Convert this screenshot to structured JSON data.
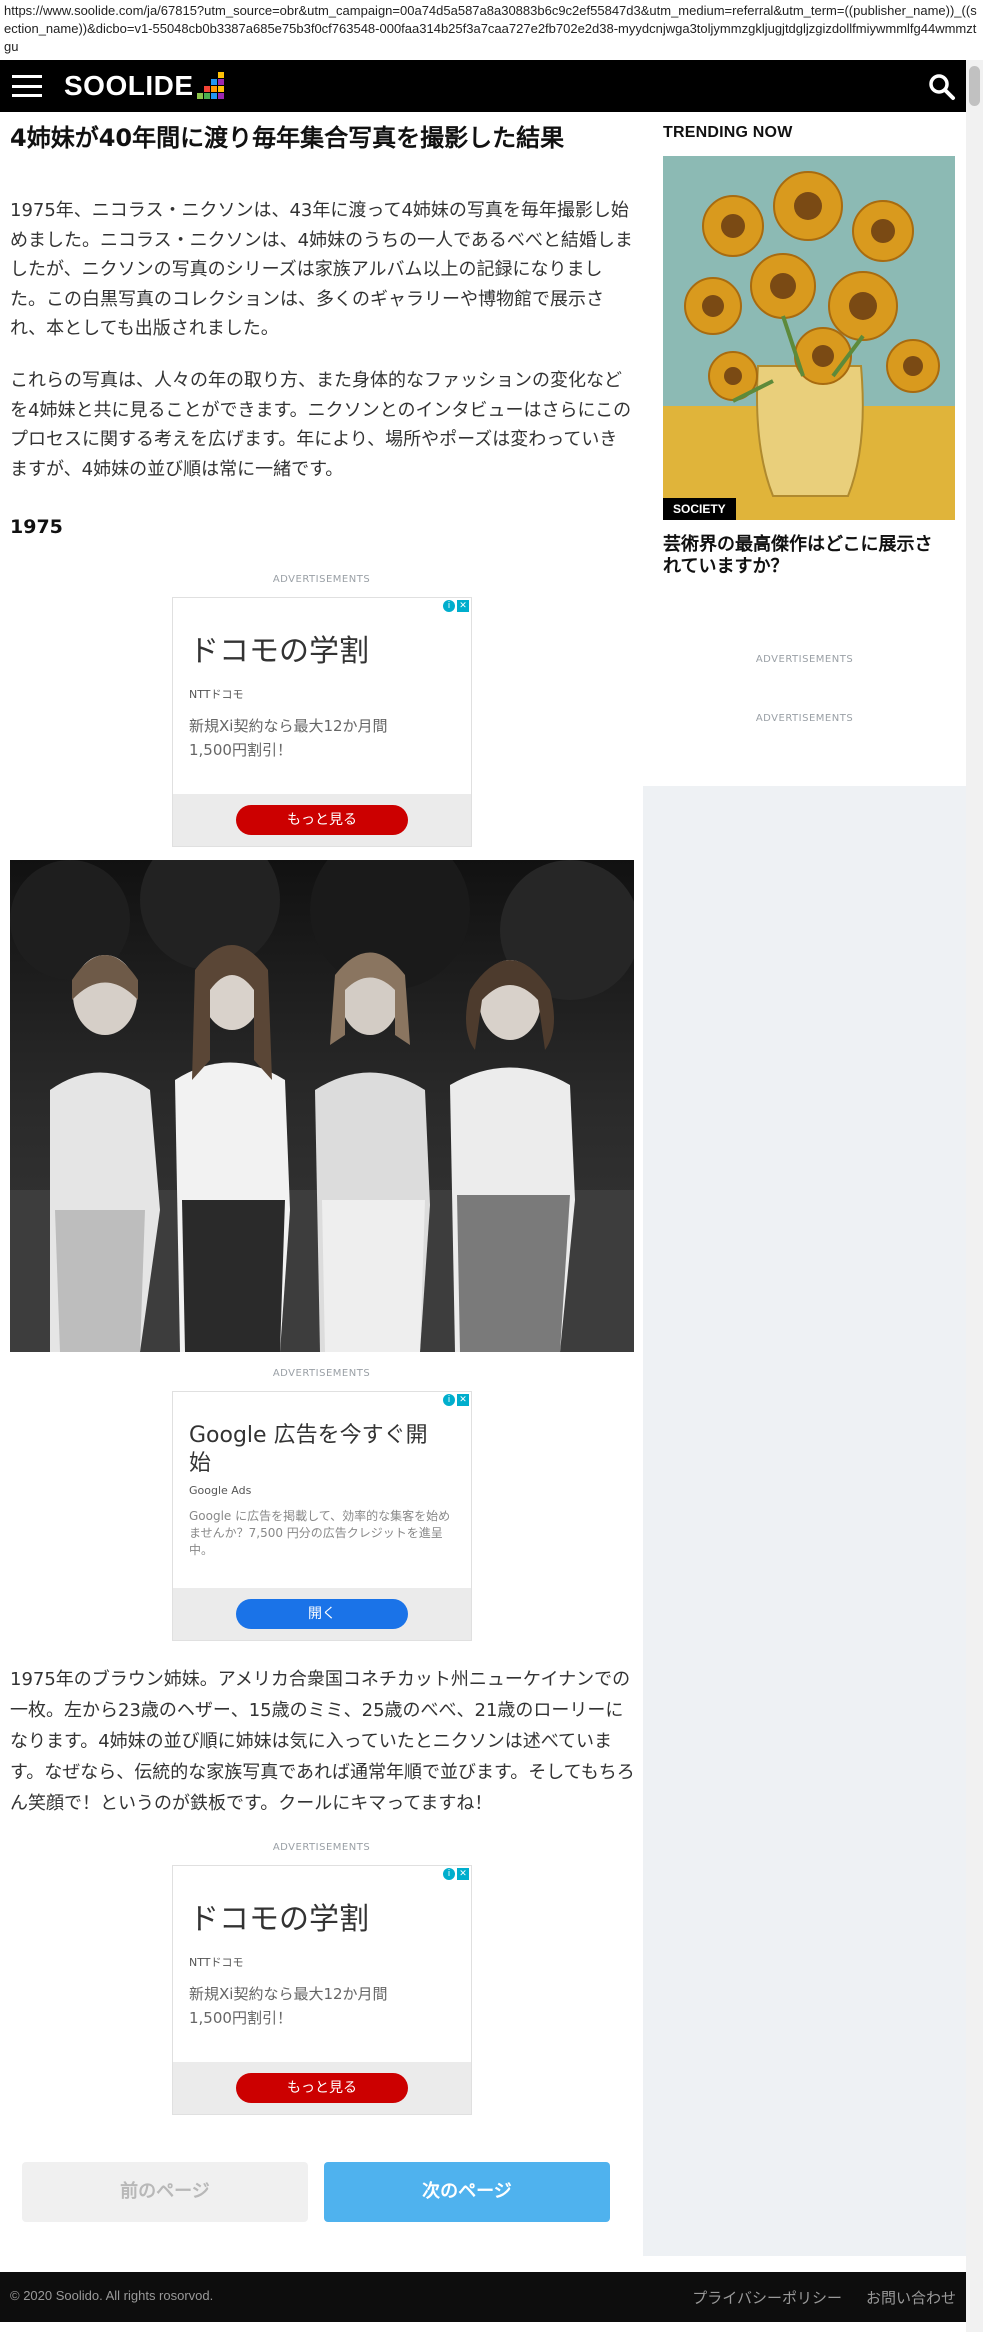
{
  "url": "https://www.soolide.com/ja/67815?utm_source=obr&utm_campaign=00a74d5a587a8a30883b6c9c2ef55847d3&utm_medium=referral&utm_term=((publisher_name))_((section_name))&dicbo=v1-55048cb0b3387a685e75b3f0cf763548-000faa314b25f3a7caa727e2fb702e2d38-myydcnjwga3toljymmzgkljugjtdgljzgizdollfmiywmmlfg44wmmztgu",
  "brand": {
    "logo": "SOOLIDE",
    "accent_colors": [
      "#e91e63",
      "#f44336",
      "#ff9800",
      "#ffc107",
      "#8bc34a",
      "#4caf50",
      "#2196f3",
      "#9c27b0"
    ]
  },
  "article": {
    "title": "4姉妹が40年間に渡り毎年集合写真を撮影した結果",
    "para1": "1975年、ニコラス・ニクソンは、43年に渡って4姉妹の写真を毎年撮影し始めました。ニコラス・ニクソンは、4姉妹のうちの一人であるべべと結婚しましたが、ニクソンの写真のシリーズは家族アルバム以上の記録になりました。この白黒写真のコレクションは、多くのギャラリーや博物館で展示され、本としても出版されました。",
    "para2": "これらの写真は、人々の年の取り方、また身体的なファッションの変化などを4姉妹と共に見ることができます。ニクソンとのインタビューはさらにこのプロセスに関する考えを広げます。年により、場所やポーズは変わっていきますが、4姉妹の並び順は常に一緒です。",
    "year": "1975",
    "caption": "1975年のブラウン姉妹。アメリカ合衆国コネチカット州ニューケイナンでの一枚。左から23歳のヘザー、15歳のミミ、25歳のべべ、21歳のローリーになります。4姉妹の並び順に姉妹は気に入っていたとニクソンは述べています。なぜなら、伝統的な家族写真であれば通常年順で並びます。そしてもちろん笑顔で！というのが鉄板です。クールにキマってますね！"
  },
  "ads": {
    "label": "ADVERTISEMENTS",
    "docomo": {
      "headline": "ドコモの学割",
      "brand": "NTTドコモ",
      "desc": "新規Xi契約なら最大12か月間 1,500円割引！",
      "button": "もっと見る",
      "button_color": "#cc0000"
    },
    "google": {
      "headline": "Google 広告を今すぐ開始",
      "brand": "Google Ads",
      "desc": "Google に広告を掲載して、効率的な集客を始めませんか？7,500 円分の広告クレジットを進呈中。",
      "button": "開く",
      "button_color": "#1a73e8"
    }
  },
  "pager": {
    "prev": "前のページ",
    "next": "次のページ"
  },
  "sidebar": {
    "trending_label": "TRENDING NOW",
    "card": {
      "tag": "SOCIETY",
      "title": "芸術界の最高傑作はどこに展示されていますか？"
    }
  },
  "footer": {
    "copyright": "© 2020 Soolido. All rights rosorvod.",
    "privacy": "プライバシーポリシー",
    "contact": "お問い合わせ"
  }
}
